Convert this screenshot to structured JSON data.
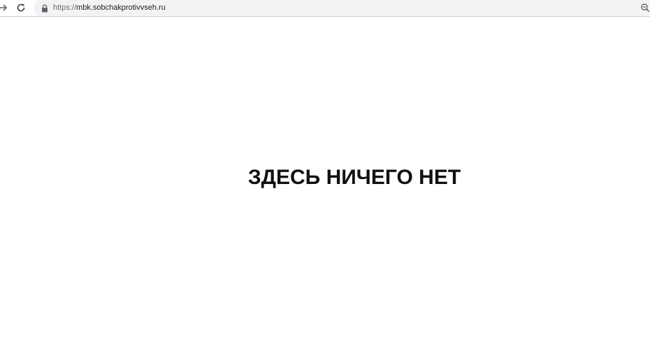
{
  "browser": {
    "url_scheme": "https://",
    "url_host": "mbk.sobchakprotivvseh.ru",
    "icons": {
      "forward": "arrow-right-icon",
      "reload": "reload-icon",
      "lock": "lock-icon",
      "zoom": "magnifier-icon"
    }
  },
  "page": {
    "message": "ЗДЕСЬ НИЧЕГО НЕТ"
  },
  "colors": {
    "toolbar_bg": "#ffffff",
    "omnibox_bg": "#f1f3f4",
    "text": "#111111"
  }
}
